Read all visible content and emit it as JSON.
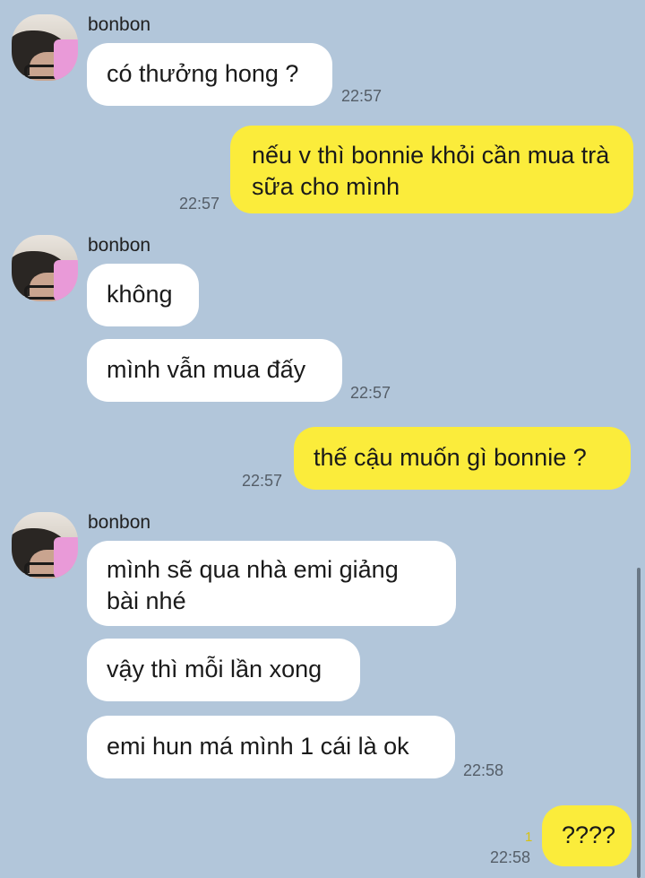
{
  "contact": {
    "name": "bonbon"
  },
  "messages": [
    {
      "from": "bonbon",
      "text": "có thưởng hong ?",
      "time": "22:57"
    },
    {
      "from": "me",
      "text": "nếu v thì bonnie khỏi cần mua trà sữa cho mình",
      "time": "22:57"
    },
    {
      "from": "bonbon",
      "text": "không",
      "time": ""
    },
    {
      "from": "bonbon",
      "text": "mình vẫn mua đấy",
      "time": "22:57"
    },
    {
      "from": "me",
      "text": "thế cậu muốn gì bonnie ?",
      "time": "22:57"
    },
    {
      "from": "bonbon",
      "text": "mình sẽ qua nhà emi giảng bài nhé",
      "time": ""
    },
    {
      "from": "bonbon",
      "text": "vậy thì mỗi lần xong",
      "time": ""
    },
    {
      "from": "bonbon",
      "text": "emi hun má mình 1 cái là ok",
      "time": "22:58"
    },
    {
      "from": "me",
      "text": "????",
      "time": "22:58",
      "unread_count": "1"
    }
  ],
  "colors": {
    "background": "#b2c6da",
    "incoming_bubble": "#ffffff",
    "outgoing_bubble": "#fbec3b",
    "unread": "#d8c20f"
  }
}
